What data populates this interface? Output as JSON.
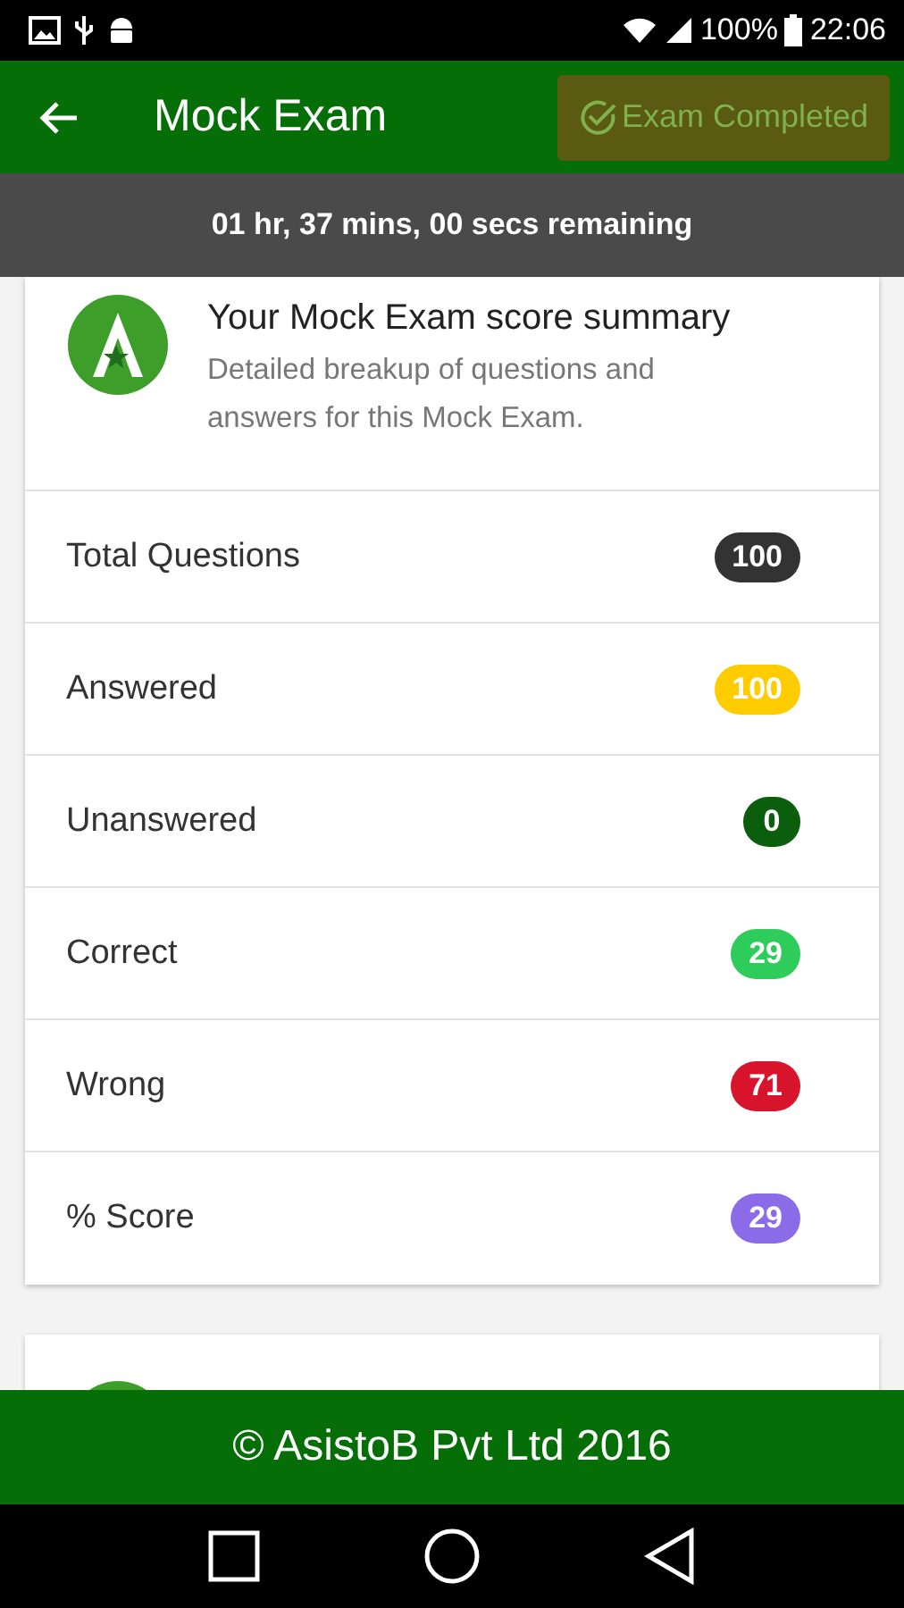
{
  "status_bar": {
    "battery": "100%",
    "time": "22:06"
  },
  "app_bar": {
    "title": "Mock Exam",
    "action": {
      "label": "Exam Completed",
      "disabled": true
    }
  },
  "timer": "01 hr, 37 mins, 00 secs remaining",
  "summary": {
    "title": "Your Mock Exam score summary",
    "subtitle": "Detailed breakup of questions and answers for this Mock Exam.",
    "rows": [
      {
        "label": "Total Questions",
        "value": "100",
        "color": "#333333"
      },
      {
        "label": "Answered",
        "value": "100",
        "color": "#ffcc00"
      },
      {
        "label": "Unanswered",
        "value": "0",
        "color": "#0b5e0b"
      },
      {
        "label": "Correct",
        "value": "29",
        "color": "#2ecc5a"
      },
      {
        "label": "Wrong",
        "value": "71",
        "color": "#d7142c"
      },
      {
        "label": "% Score",
        "value": "29",
        "color": "#8c6be8"
      }
    ]
  },
  "footer": "© AsistoB Pvt Ltd 2016"
}
